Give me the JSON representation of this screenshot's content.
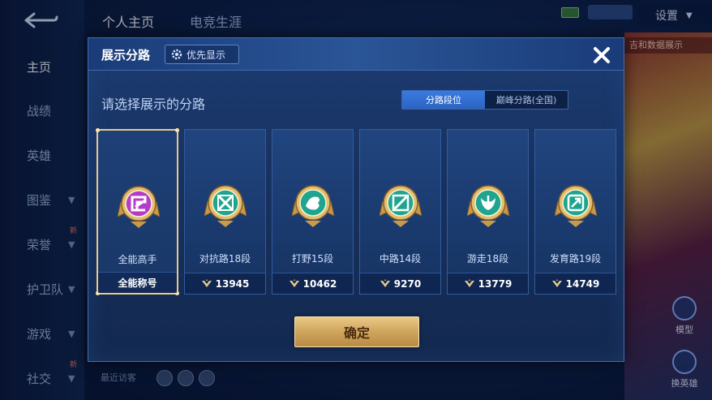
{
  "top_tabs": [
    "个人主页",
    "电竞生涯"
  ],
  "settings_label": "设置",
  "right_banner": "吉和数据展示",
  "right_buttons": [
    "模型",
    "换英雄"
  ],
  "sidebar": {
    "items": [
      {
        "label": "主页",
        "active": true,
        "chevron": false,
        "new": false
      },
      {
        "label": "战绩",
        "active": false,
        "chevron": false,
        "new": false
      },
      {
        "label": "英雄",
        "active": false,
        "chevron": false,
        "new": false
      },
      {
        "label": "图鉴",
        "active": false,
        "chevron": true,
        "new": false
      },
      {
        "label": "荣誉",
        "active": false,
        "chevron": true,
        "new": true
      },
      {
        "label": "护卫队",
        "active": false,
        "chevron": true,
        "new": false
      },
      {
        "label": "游戏",
        "active": false,
        "chevron": true,
        "new": false
      },
      {
        "label": "社交",
        "active": false,
        "chevron": true,
        "new": true
      }
    ],
    "new_badge": "新"
  },
  "recent_visitors_label": "最近访客",
  "modal": {
    "title": "展示分路",
    "priority_label": "优先显示",
    "subtitle": "请选择展示的分路",
    "toggle": {
      "left": "分路段位",
      "right": "巅峰分路(全国)",
      "active": "left"
    },
    "cards": [
      {
        "name": "全能高手",
        "stat": "全能称号",
        "selected": true,
        "icon": "all-round-icon",
        "color": "#b43cc8"
      },
      {
        "name": "对抗路18段",
        "stat": "13945",
        "selected": false,
        "icon": "clash-lane-icon",
        "color": "#1fa58f"
      },
      {
        "name": "打野15段",
        "stat": "10462",
        "selected": false,
        "icon": "jungle-icon",
        "color": "#1fa58f"
      },
      {
        "name": "中路14段",
        "stat": "9270",
        "selected": false,
        "icon": "mid-lane-icon",
        "color": "#1fa58f"
      },
      {
        "name": "游走18段",
        "stat": "13779",
        "selected": false,
        "icon": "roam-icon",
        "color": "#1fa58f"
      },
      {
        "name": "发育路19段",
        "stat": "14749",
        "selected": false,
        "icon": "farm-lane-icon",
        "color": "#1fa58f"
      }
    ],
    "confirm_label": "确定"
  },
  "colors": {
    "accent_blue": "#2c64c2",
    "gold": "#cfa45c",
    "card_border_selected": "#e8c98a"
  }
}
